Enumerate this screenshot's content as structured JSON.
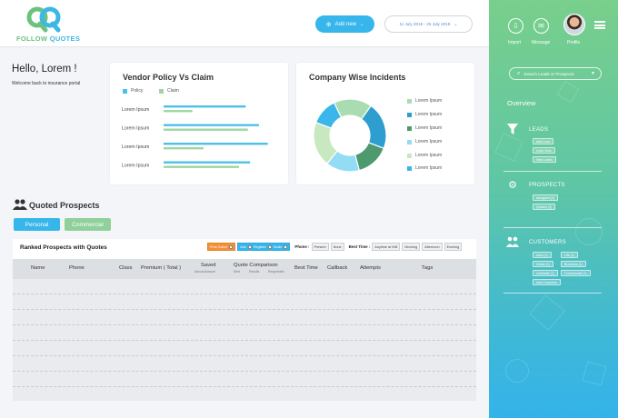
{
  "brand": {
    "name_part1": "FOLLOW",
    "name_part2": "QUOTES",
    "mark_letters": "QQ",
    "colors": {
      "green": "#6cc27d",
      "blue": "#3db7e4"
    }
  },
  "header": {
    "add_new_label": "Add new",
    "date_range": "11 July 2019 - 25 July 2019"
  },
  "greeting": {
    "title": "Hello, Lorem !",
    "subtitle": "Welcome back to insurance portal"
  },
  "vendor_chart": {
    "title": "Vendor Policy Vs Claim",
    "legend": [
      {
        "label": "Policy",
        "color": "#4cc0ea"
      },
      {
        "label": "Claim",
        "color": "#9fd6a3"
      }
    ],
    "categories": [
      "Lorem Ipsum",
      "Lorem Ipsum",
      "Lorem Ipsum",
      "Lorem Ipsum"
    ]
  },
  "incidents_chart": {
    "title": "Company Wise Incidents",
    "legend": [
      {
        "label": "Lorem Ipsum",
        "color": "#a9dcb0"
      },
      {
        "label": "Lorem Ipsum",
        "color": "#2e9ed0"
      },
      {
        "label": "Lorem Ipsum",
        "color": "#4e9a6f"
      },
      {
        "label": "Lorem Ipsum",
        "color": "#92dcf4"
      },
      {
        "label": "Lorem Ipsum",
        "color": "#c8e8c0"
      },
      {
        "label": "Lorem Ipsum",
        "color": "#3ab6ea"
      }
    ]
  },
  "chart_data": [
    {
      "type": "bar",
      "title": "Vendor Policy Vs Claim",
      "orientation": "horizontal",
      "categories": [
        "Lorem Ipsum",
        "Lorem Ipsum",
        "Lorem Ipsum",
        "Lorem Ipsum"
      ],
      "series": [
        {
          "name": "Policy",
          "values": [
            74,
            86,
            94,
            78
          ]
        },
        {
          "name": "Claim",
          "values": [
            26,
            76,
            36,
            68
          ]
        }
      ],
      "xlim": [
        0,
        100
      ],
      "grid": false,
      "legend_position": "top-left"
    },
    {
      "type": "pie",
      "title": "Company Wise Incidents",
      "donut": true,
      "labels": [
        "Lorem Ipsum",
        "Lorem Ipsum",
        "Lorem Ipsum",
        "Lorem Ipsum",
        "Lorem Ipsum",
        "Lorem Ipsum"
      ],
      "values": [
        17,
        21,
        15,
        15,
        20,
        12
      ],
      "colors": [
        "#a9dcb0",
        "#2e9ed0",
        "#4e9a6f",
        "#92dcf4",
        "#c8e8c0",
        "#3ab6ea"
      ],
      "legend_position": "right"
    }
  ],
  "quoted": {
    "title": "Quoted Prospects",
    "tabs": [
      "Personal",
      "Commercial"
    ],
    "table_title": "Ranked Prospects with Quotes",
    "filters": {
      "chips_group1": [
        "Free Game",
        "Ans",
        "Register",
        "Scale"
      ],
      "phone_label": "Phone :",
      "phone_options": [
        "Present",
        "None"
      ],
      "besttime_label": "Best Time :",
      "besttime_options": [
        "Anytime at Will",
        "Morning",
        "Afternoon",
        "Evening"
      ]
    },
    "columns": {
      "name": "Name",
      "phone": "Phone",
      "class": "Class",
      "premium": "Premium ( Total )",
      "saved": "Saved",
      "saved_sub": "Annual Amount",
      "quote_comparison": "Quote Comparison",
      "qc_sub1": "Sent",
      "qc_sub2": "Results",
      "qc_sub3": "Responded",
      "best_time": "Best Time",
      "callback": "Callback",
      "attempts": "Attempts",
      "tags": "Tags"
    }
  },
  "sidebar": {
    "top_actions": [
      {
        "label": "Import",
        "icon": "import-icon"
      },
      {
        "label": "Message",
        "icon": "mail-icon"
      },
      {
        "label": "Profile",
        "icon": "avatar"
      }
    ],
    "search_placeholder": "Search Leads or Prospects",
    "overview": "Overview",
    "leads": {
      "title": "LEADS",
      "items": [
        "Add Lead",
        "Lead View",
        "New Leads"
      ]
    },
    "prospects": {
      "title": "PROSPECTS",
      "items": [
        "Assigned (1)",
        "Quoted (1)"
      ]
    },
    "customers": {
      "title": "CUSTOMERS",
      "items": [
        "Auto (1)",
        "Life (1)",
        "Home (1)",
        "Business (1)",
        "Umbrella (1)",
        "Commercial (1)",
        "Add Customer"
      ]
    }
  }
}
